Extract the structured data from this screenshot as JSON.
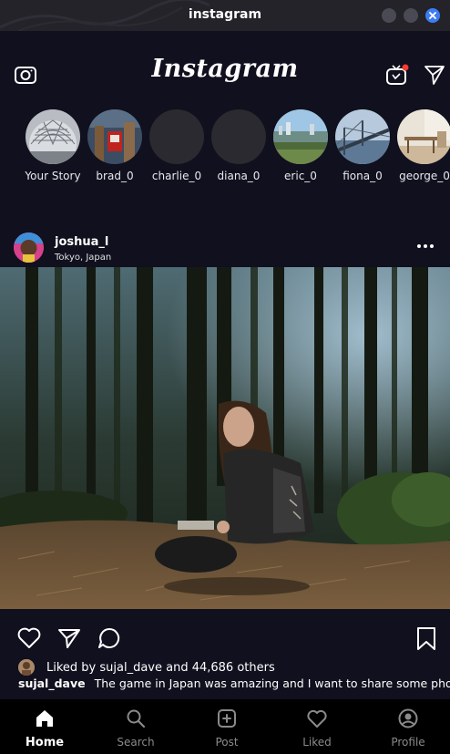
{
  "window": {
    "title": "instagram"
  },
  "header": {
    "logo": "Instagram",
    "notification_dot_color": "#ff3b30"
  },
  "stories": [
    {
      "label": "Your Story"
    },
    {
      "label": "brad_0"
    },
    {
      "label": "charlie_0"
    },
    {
      "label": "diana_0"
    },
    {
      "label": "eric_0"
    },
    {
      "label": "fiona_0"
    },
    {
      "label": "george_0"
    }
  ],
  "post": {
    "username": "joshua_l",
    "location": "Tokyo, Japan",
    "likes_text": "Liked by sujal_dave and 44,686 others",
    "caption_user": "sujal_dave",
    "caption_text": "The game in Japan was amazing and I want to share some photos"
  },
  "tabs": [
    {
      "label": "Home",
      "icon": "home-icon",
      "active": true
    },
    {
      "label": "Search",
      "icon": "search-icon",
      "active": false
    },
    {
      "label": "Post",
      "icon": "plus-square-icon",
      "active": false
    },
    {
      "label": "Liked",
      "icon": "heart-icon",
      "active": false
    },
    {
      "label": "Profile",
      "icon": "profile-icon",
      "active": false
    }
  ],
  "colors": {
    "background": "#10101e",
    "titlebar": "#232329",
    "close_button": "#3d7cf2",
    "tabbar": "#000000"
  }
}
